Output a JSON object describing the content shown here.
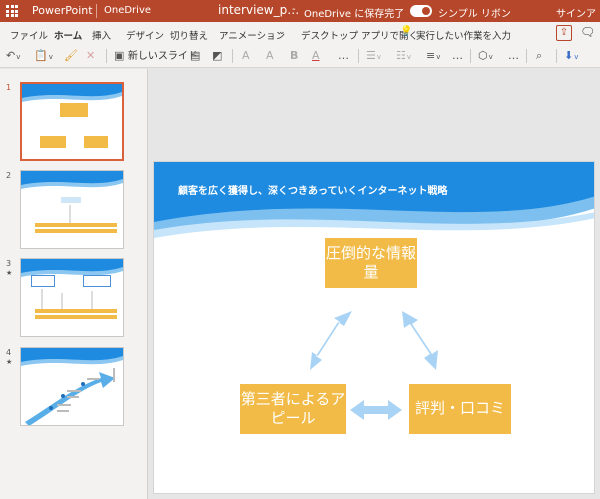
{
  "titlebar": {
    "app_name": "PowerPoint",
    "service": "OneDrive",
    "document_name": "interview_p…",
    "separator": "-",
    "save_status": "OneDrive に保存完了",
    "simple_ribbon_label": "シンプル リボン",
    "sign_in": "サインアウト"
  },
  "tabs": [
    "ファイル",
    "ホーム",
    "挿入",
    "デザイン",
    "切り替え",
    "アニメーション"
  ],
  "tabs_more": {
    "open_desktop": "デスクトップ アプリで開く",
    "tell_me": "実行したい作業を入力"
  },
  "toolbar": {
    "new_slide": "新しいスライド",
    "font_grow": "A",
    "font_shrink": "A",
    "bold": "B",
    "font_color": "A",
    "more": "…",
    "dropdown": "v"
  },
  "thumbnails": [
    {
      "number": "1",
      "star": ""
    },
    {
      "number": "2",
      "star": ""
    },
    {
      "number": "3",
      "star": "★"
    },
    {
      "number": "4",
      "star": "★"
    }
  ],
  "slide": {
    "title": "顧客を広く獲得し、深くつきあっていくインターネット戦略",
    "box_top": "圧倒的な情報量",
    "box_left": "第三者によるアピール",
    "box_right": "評判・口コミ"
  },
  "colors": {
    "brand": "#b7472a",
    "box": "#f2bb48",
    "arrow": "#a9d3f5",
    "wave": "#1e8be0"
  },
  "icons": [
    "waffle-icon",
    "undo-icon",
    "clipboard-icon",
    "format-painter-icon",
    "clear-icon",
    "new-slide-icon",
    "layout-icon",
    "shape-fill-icon",
    "bulb-icon",
    "share-icon",
    "comment-icon",
    "search-icon",
    "bullets-icon",
    "numbering-icon",
    "align-icon",
    "shapes-icon",
    "arrange-icon"
  ]
}
